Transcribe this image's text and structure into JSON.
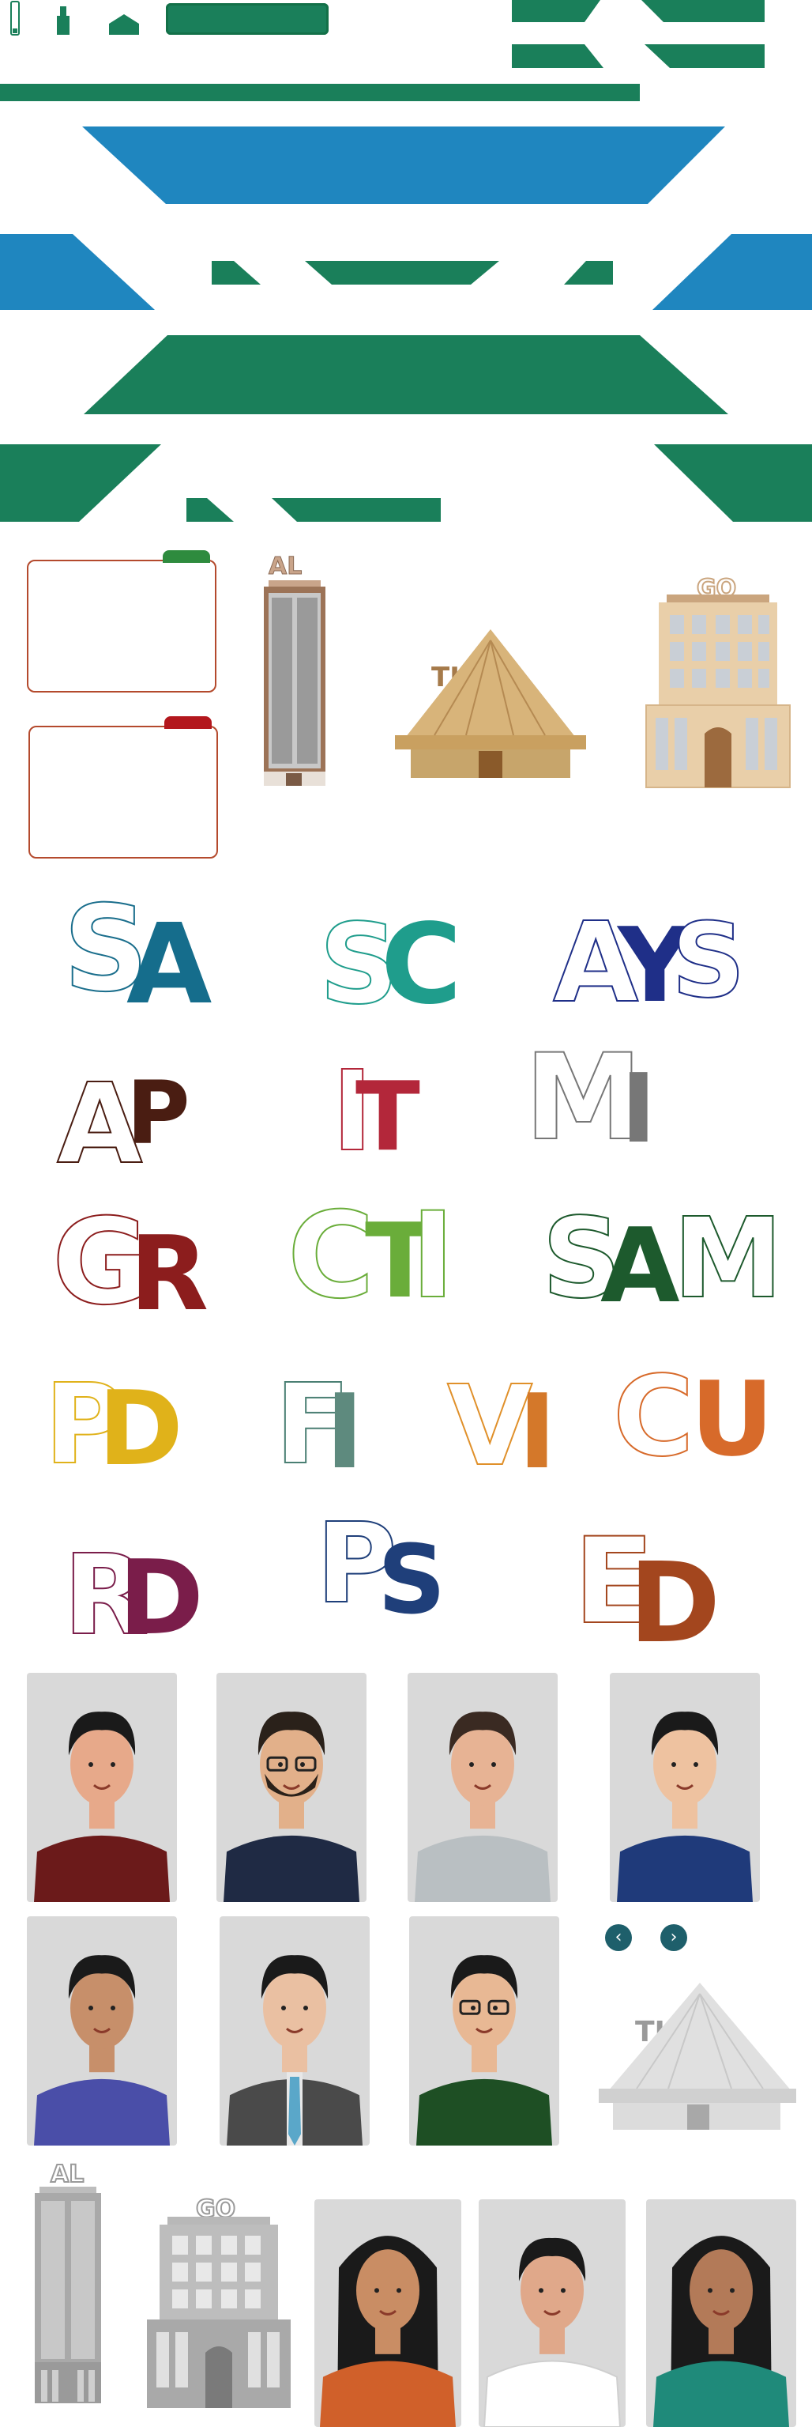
{
  "colors": {
    "green": "#1a7f5a",
    "blue": "#1f86bf",
    "folder_border": "#b44a2d",
    "tab_green": "#2e8b3e",
    "tab_red": "#b3171d",
    "hut_straw": "#d8b47a",
    "building_tan": "#e9cfa9",
    "tower_brown": "#9c7357",
    "card_bg": "#d9d9d9",
    "nav_teal": "#1e5f6b"
  },
  "icons": {
    "small_tall_rect": "phone-icon",
    "small_block": "bottle-icon",
    "small_house": "house-icon",
    "wide_button": "pill-button"
  },
  "building_labels": {
    "tower": "AL",
    "hut": "TI",
    "office": "GO"
  },
  "logos": [
    {
      "outline": "S",
      "fill": "A",
      "outline_color": "#1a6e8c",
      "fill_color": "#156d8c"
    },
    {
      "outline": "S",
      "fill": "C",
      "outline_color": "#1f9d8c",
      "fill_color": "#1f9d8c"
    },
    {
      "outline": "A",
      "fill": "Y",
      "trail": "S",
      "outline_color": "#1f2f88",
      "fill_color": "#1f2f88"
    },
    {
      "outline": "A",
      "fill": "P",
      "outline_color": "#4a1d12",
      "fill_color": "#4a1d12"
    },
    {
      "outline": "I",
      "fill": "T",
      "outline_color": "#b3273a",
      "fill_color": "#b3273a"
    },
    {
      "outline": "M",
      "fill": "I",
      "outline_color": "#777777",
      "fill_color": "#777777"
    },
    {
      "outline": "G",
      "fill": "R",
      "outline_color": "#8c1d1d",
      "fill_color": "#8c1d1d"
    },
    {
      "outline": "C",
      "fill": "T",
      "trail": "I",
      "outline_color": "#6aad3a",
      "fill_color": "#6aad3a"
    },
    {
      "outline": "S",
      "fill": "A",
      "trail": "M",
      "outline_color": "#1d5a2d",
      "fill_color": "#1d5a2d"
    },
    {
      "outline": "P",
      "fill": "D",
      "outline_color": "#e0b21a",
      "fill_color": "#e0b21a"
    },
    {
      "outline": "F",
      "fill": "I",
      "outline_color": "#4a7f73",
      "fill_color": "#5e8a7e"
    },
    {
      "outline": "V",
      "fill": "I",
      "outline_color": "#e0902a",
      "fill_color": "#d4782a"
    },
    {
      "outline": "C",
      "fill": "U",
      "outline_color": "#d76a2a",
      "fill_color": "#d76a2a"
    },
    {
      "outline": "R",
      "fill": "D",
      "outline_color": "#7a1d4a",
      "fill_color": "#7a1d4a"
    },
    {
      "outline": "P",
      "fill": "S",
      "outline_color": "#1f3f7a",
      "fill_color": "#1f3f7a"
    },
    {
      "outline": "E",
      "fill": "D",
      "outline_color": "#a3461e",
      "fill_color": "#a3461e"
    }
  ],
  "avatars": [
    {
      "name": "avatar-man-red-shirt",
      "shirt": "#6b1a1a",
      "skin": "#e7a98a",
      "hair": "#1a1a1a"
    },
    {
      "name": "avatar-man-beard-glasses",
      "shirt": "#1f2a44",
      "skin": "#e2b08a",
      "hair": "#2a211a"
    },
    {
      "name": "avatar-man-grey-suit",
      "shirt": "#b9bfc2",
      "skin": "#e7b394",
      "hair": "#3a2a22"
    },
    {
      "name": "avatar-man-blue-suit",
      "shirt": "#1f3a7a",
      "skin": "#eec2a0",
      "hair": "#1a1a1a"
    },
    {
      "name": "avatar-man-purple-shirt",
      "shirt": "#4a4ea8",
      "skin": "#c78f6a",
      "hair": "#1a1a1a"
    },
    {
      "name": "avatar-man-dark-suit-tie",
      "shirt": "#4a4a4a",
      "skin": "#eac0a2",
      "hair": "#1a1a1a"
    },
    {
      "name": "avatar-man-green-shirt-glasses",
      "shirt": "#1e4f24",
      "skin": "#e8b894",
      "hair": "#1a1a1a"
    },
    {
      "name": "avatar-woman-orange-top",
      "shirt": "#d0602a",
      "skin": "#c98d64",
      "hair": "#1a1a1a"
    },
    {
      "name": "avatar-man-white-polo",
      "shirt": "#ffffff",
      "skin": "#e0a88a",
      "hair": "#1a1a1a"
    },
    {
      "name": "avatar-woman-teal-dress",
      "shirt": "#1f8a7a",
      "skin": "#b37a58",
      "hair": "#1a1a1a"
    }
  ],
  "nav": {
    "prev": "‹",
    "next": "›"
  }
}
